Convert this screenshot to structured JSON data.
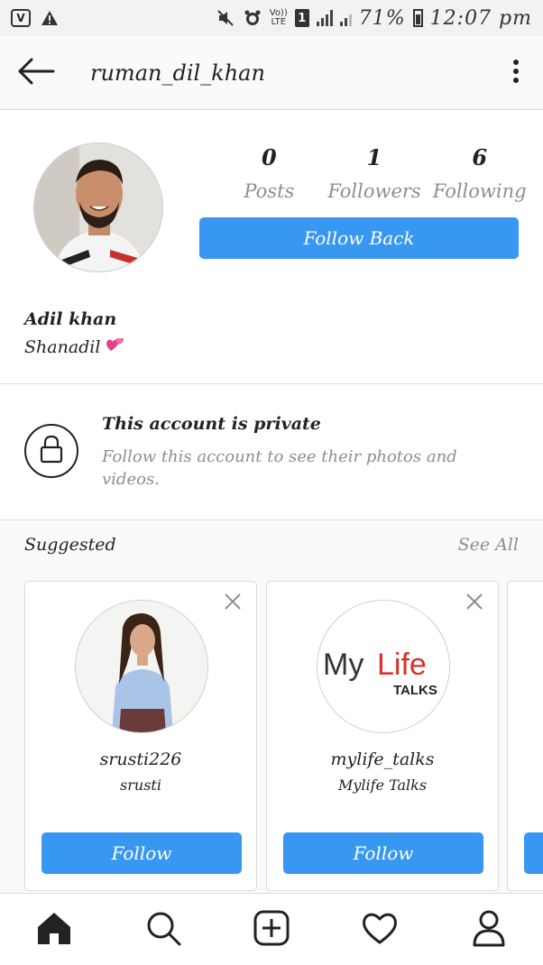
{
  "status_bar": {
    "volte": "Vo))",
    "lte": "LTE",
    "sim": "1",
    "battery": "71%",
    "time": "12:07 pm"
  },
  "header": {
    "username": "ruman_dil_khan"
  },
  "profile": {
    "stats": [
      {
        "value": "0",
        "label": "Posts"
      },
      {
        "value": "1",
        "label": "Followers"
      },
      {
        "value": "6",
        "label": "Following"
      }
    ],
    "follow_back_label": "Follow Back",
    "full_name": "Adil khan",
    "bio": "Shanadil"
  },
  "private": {
    "title": "This account is private",
    "subtitle": "Follow this account to see their photos and videos."
  },
  "suggested": {
    "title": "Suggested",
    "see_all": "See All",
    "cards": [
      {
        "username": "srusti226",
        "name": "srusti",
        "follow_label": "Follow"
      },
      {
        "username": "mylife_talks",
        "name": "Mylife Talks",
        "follow_label": "Follow",
        "logo_text_my": "My",
        "logo_text_life": "Life",
        "logo_text_talks": "TALKS"
      }
    ]
  },
  "colors": {
    "accent": "#3897f0",
    "muted": "#8e8e8e",
    "divider": "#dbdbdb"
  }
}
